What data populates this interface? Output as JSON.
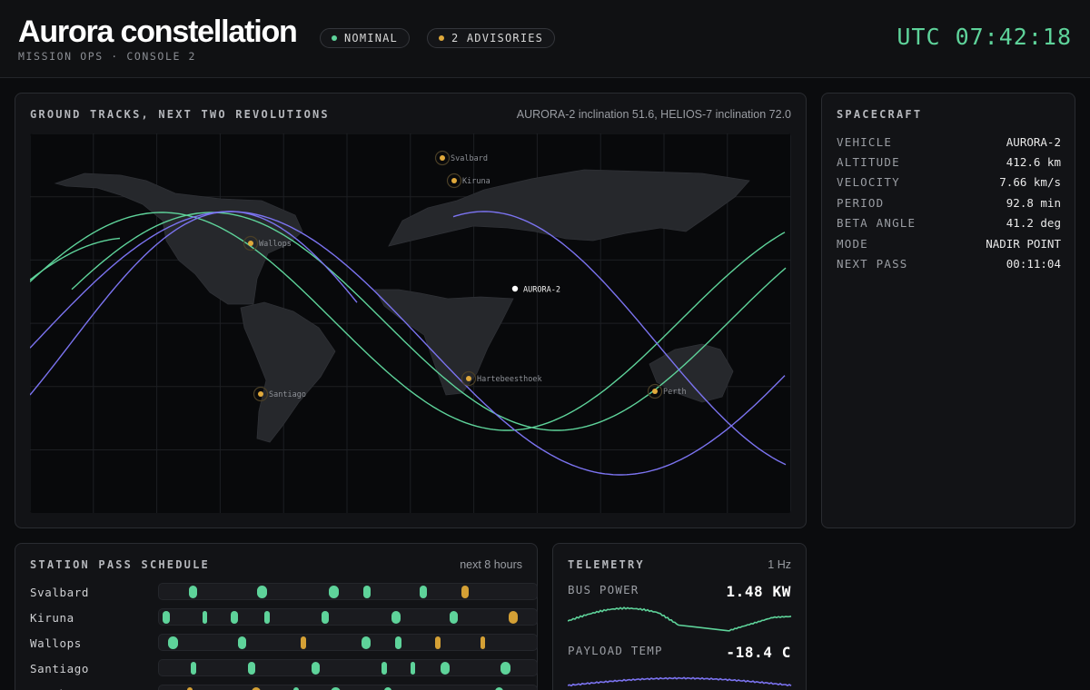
{
  "header": {
    "title": "Aurora constellation",
    "subtitle": "MISSION OPS · CONSOLE 2",
    "status_pills": [
      {
        "label": "NOMINAL",
        "color": "#5ed39a"
      },
      {
        "label": "2 ADVISORIES",
        "color": "#e0a93b"
      }
    ],
    "clock": "UTC 07:42:18"
  },
  "map": {
    "title": "GROUND TRACKS, NEXT TWO REVOLUTIONS",
    "note": "AURORA-2 inclination 51.6, HELIOS-7 inclination 72.0",
    "track_colors": {
      "aurora": "#7b73f0",
      "helios": "#5ed39a"
    },
    "stations": [
      {
        "name": "Svalbard"
      },
      {
        "name": "Kiruna"
      },
      {
        "name": "Wallops"
      },
      {
        "name": "Hartebeesthoek"
      },
      {
        "name": "Santiago"
      },
      {
        "name": "Perth"
      }
    ],
    "spacecraft_marker": "AURORA-2",
    "station_color": "#e0a93b"
  },
  "spacecraft": {
    "title": "SPACECRAFT",
    "rows": [
      {
        "key": "VEHICLE",
        "value": "AURORA-2"
      },
      {
        "key": "ALTITUDE",
        "value": "412.6 km"
      },
      {
        "key": "VELOCITY",
        "value": "7.66 km/s"
      },
      {
        "key": "PERIOD",
        "value": "92.8 min"
      },
      {
        "key": "BETA ANGLE",
        "value": "41.2 deg"
      },
      {
        "key": "MODE",
        "value": "NADIR POINT"
      },
      {
        "key": "NEXT PASS",
        "value": "00:11:04"
      }
    ]
  },
  "schedule": {
    "title": "STATION PASS SCHEDULE",
    "note": "next 8 hours",
    "pass_colors": {
      "normal": "#5ed39a",
      "advisory": "#d4a035"
    },
    "rows": [
      {
        "station": "Svalbard",
        "passes": [
          {
            "t": 0.08,
            "w": 0.02
          },
          {
            "t": 0.26,
            "w": 0.025
          },
          {
            "t": 0.45,
            "w": 0.025
          },
          {
            "t": 0.54,
            "w": 0.02
          },
          {
            "t": 0.69,
            "w": 0.018
          },
          {
            "t": 0.8,
            "w": 0.02,
            "advisory": true
          }
        ]
      },
      {
        "station": "Kiruna",
        "passes": [
          {
            "t": 0.01,
            "w": 0.02
          },
          {
            "t": 0.115,
            "w": 0.01
          },
          {
            "t": 0.19,
            "w": 0.02
          },
          {
            "t": 0.28,
            "w": 0.008
          },
          {
            "t": 0.43,
            "w": 0.02
          },
          {
            "t": 0.615,
            "w": 0.025
          },
          {
            "t": 0.77,
            "w": 0.02
          },
          {
            "t": 0.925,
            "w": 0.025,
            "advisory": true
          }
        ]
      },
      {
        "station": "Wallops",
        "passes": [
          {
            "t": 0.025,
            "w": 0.025
          },
          {
            "t": 0.21,
            "w": 0.02
          },
          {
            "t": 0.375,
            "w": 0.015,
            "advisory": true
          },
          {
            "t": 0.535,
            "w": 0.025
          },
          {
            "t": 0.625,
            "w": 0.018
          },
          {
            "t": 0.73,
            "w": 0.015,
            "advisory": true
          },
          {
            "t": 0.85,
            "w": 0.012,
            "advisory": true
          }
        ]
      },
      {
        "station": "Santiago",
        "passes": [
          {
            "t": 0.085,
            "w": 0.012
          },
          {
            "t": 0.235,
            "w": 0.02
          },
          {
            "t": 0.405,
            "w": 0.02
          },
          {
            "t": 0.59,
            "w": 0.012
          },
          {
            "t": 0.665,
            "w": 0.01
          },
          {
            "t": 0.745,
            "w": 0.025
          },
          {
            "t": 0.905,
            "w": 0.025
          }
        ]
      },
      {
        "station": "Perth",
        "passes": [
          {
            "t": 0.075,
            "w": 0.012,
            "advisory": true
          },
          {
            "t": 0.245,
            "w": 0.025,
            "advisory": true
          },
          {
            "t": 0.355,
            "w": 0.015
          },
          {
            "t": 0.455,
            "w": 0.025
          },
          {
            "t": 0.595,
            "w": 0.02
          },
          {
            "t": 0.89,
            "w": 0.02
          }
        ]
      }
    ]
  },
  "telemetry": {
    "title": "TELEMETRY",
    "note": "1 Hz",
    "metrics": [
      {
        "label": "BUS POWER",
        "value": "1.48 KW",
        "color": "#5ed39a"
      },
      {
        "label": "PAYLOAD TEMP",
        "value": "-18.4 C",
        "color": "#7b73f0"
      }
    ]
  }
}
